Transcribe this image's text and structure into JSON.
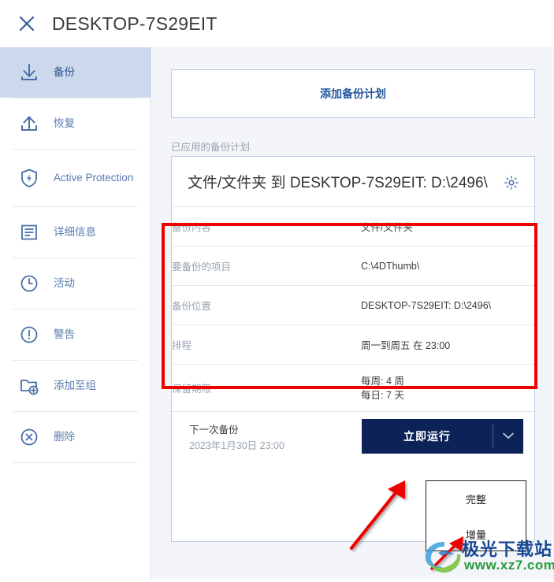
{
  "window": {
    "title": "DESKTOP-7S29EIT",
    "close_icon": "close-icon"
  },
  "sidebar": {
    "items": [
      {
        "label": "备份",
        "icon": "download-arrow-icon",
        "active": true
      },
      {
        "label": "恢复",
        "icon": "upload-arrow-icon",
        "active": false
      },
      {
        "label": "Active Protection",
        "icon": "shield-bolt-icon",
        "active": false
      },
      {
        "label": "详细信息",
        "icon": "details-list-icon",
        "active": false
      },
      {
        "label": "活动",
        "icon": "clock-icon",
        "active": false
      },
      {
        "label": "警告",
        "icon": "warning-exclamation-icon",
        "active": false
      },
      {
        "label": "添加至组",
        "icon": "folder-plus-icon",
        "active": false
      },
      {
        "label": "删除",
        "icon": "delete-circle-x-icon",
        "active": false
      }
    ]
  },
  "main": {
    "add_plan_label": "添加备份计划",
    "applied_plans_label": "已应用的备份计划",
    "plan": {
      "title": "文件/文件夹 到 DESKTOP-7S29EIT: D:\\2496\\",
      "settings_icon": "gear-icon",
      "rows": [
        {
          "key": "备份内容",
          "value": "文件/文件夹"
        },
        {
          "key": "要备份的项目",
          "value": "C:\\4DThumb\\"
        },
        {
          "key": "备份位置",
          "value": "DESKTOP-7S29EIT: D:\\2496\\"
        },
        {
          "key": "排程",
          "value": "周一到周五 在 23:00"
        }
      ],
      "retention": {
        "key": "保留期限",
        "value_line1": "每周: 4 周",
        "value_line2": "每日: 7 天"
      },
      "next_backup": {
        "label": "下一次备份",
        "date": "2023年1月30日 23:00"
      },
      "run_button": {
        "label": "立即运行",
        "caret_icon": "chevron-down-icon"
      },
      "run_menu": {
        "items": [
          {
            "label": "完整"
          },
          {
            "label": "增量"
          }
        ]
      }
    }
  },
  "annotations": {
    "highlight_color": "#ee0000",
    "arrow_color": "#ee0000"
  },
  "watermark": {
    "site_name": "极光下载站",
    "url": "www.xz7.com",
    "logo_icon": "aurora-swirl-logo-icon"
  },
  "colors": {
    "accent_blue": "#22569e",
    "sidebar_active_bg": "#ccd9ec",
    "run_button_bg": "#0d2357",
    "main_bg": "#f3f5f8",
    "muted_text": "#9aa4b0"
  }
}
